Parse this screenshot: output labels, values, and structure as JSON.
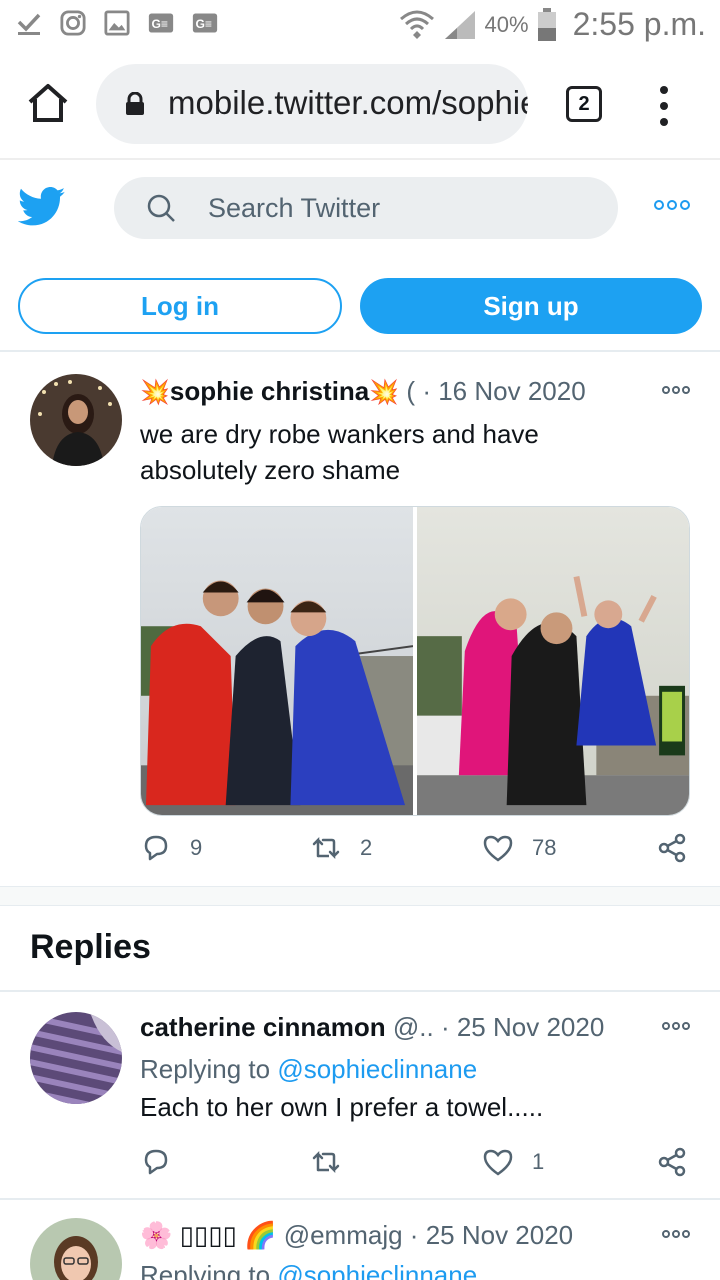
{
  "status_bar": {
    "battery": "40%",
    "time": "2:55 p.m."
  },
  "browser": {
    "url": "mobile.twitter.com/sophieclinnane",
    "tab_count": "2"
  },
  "header": {
    "search_placeholder": "Search Twitter",
    "login_label": "Log in",
    "signup_label": "Sign up"
  },
  "tweet": {
    "name_emoji_left": "💥",
    "name": "sophie christina",
    "name_emoji_right": "💥",
    "handle": "(",
    "separator": "·",
    "date": "16 Nov 2020",
    "text": "we are dry robe wankers and have absolutely zero shame",
    "replies": "9",
    "retweets": "2",
    "likes": "78"
  },
  "replies_section": {
    "title": "Replies",
    "items": [
      {
        "name": "catherine cinnamon",
        "handle": "@..",
        "separator": "·",
        "date": "25 Nov 2020",
        "replying_prefix": "Replying to ",
        "replying_handle": "@sophieclinnane",
        "text": "Each to her own I prefer a towel.....",
        "replies": "",
        "retweets": "",
        "likes": "1"
      },
      {
        "name_prefix": "🌸",
        "name": "▯▯▯▯",
        "name_suffix": "🌈",
        "handle": "@emmajg",
        "separator": "·",
        "date": "25 Nov 2020",
        "replying_prefix": "Replying to ",
        "replying_handle": "@sophieclinnane"
      }
    ]
  },
  "icons": {
    "status_left": [
      "check-icon",
      "instagram-icon",
      "image-icon",
      "keyboard-icon",
      "keyboard-icon"
    ],
    "status_right": [
      "wifi-icon",
      "signal-icon",
      "battery-icon"
    ]
  },
  "colors": {
    "twitter_blue": "#1da1f2",
    "text_secondary": "#536471"
  }
}
